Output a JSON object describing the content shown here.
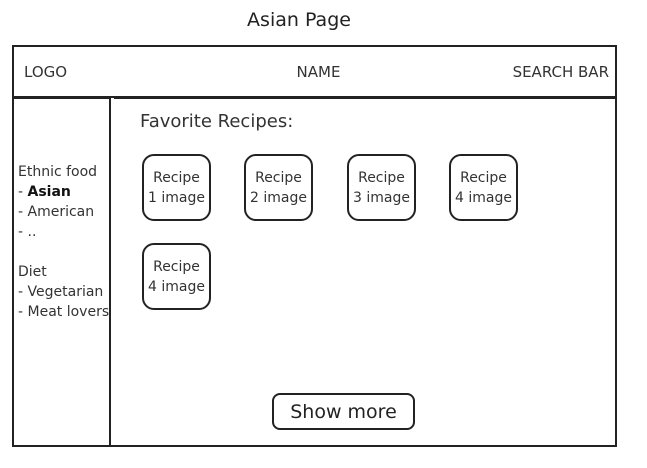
{
  "page_title": "Asian Page",
  "header": {
    "logo": "LOGO",
    "name": "NAME",
    "search": "SEARCH BAR"
  },
  "sidebar": {
    "ethnic_heading": "Ethnic food",
    "ethnic_items": [
      {
        "prefix": "- ",
        "label": "Asian",
        "active": true
      },
      {
        "prefix": "- ",
        "label": "American"
      },
      {
        "prefix": "- ",
        "label": ".."
      }
    ],
    "diet_heading": "Diet",
    "diet_items": [
      {
        "prefix": "- ",
        "label": "Vegetarian"
      },
      {
        "prefix": "- ",
        "label": "Meat lovers"
      }
    ]
  },
  "main": {
    "favorites_title": "Favorite Recipes:",
    "recipes": [
      {
        "line1": "Recipe",
        "line2": "1 image"
      },
      {
        "line1": "Recipe",
        "line2": "2 image"
      },
      {
        "line1": "Recipe",
        "line2": "3 image"
      },
      {
        "line1": "Recipe",
        "line2": "4 image"
      },
      {
        "line1": "Recipe",
        "line2": "4 image"
      }
    ],
    "show_more": "Show more"
  }
}
